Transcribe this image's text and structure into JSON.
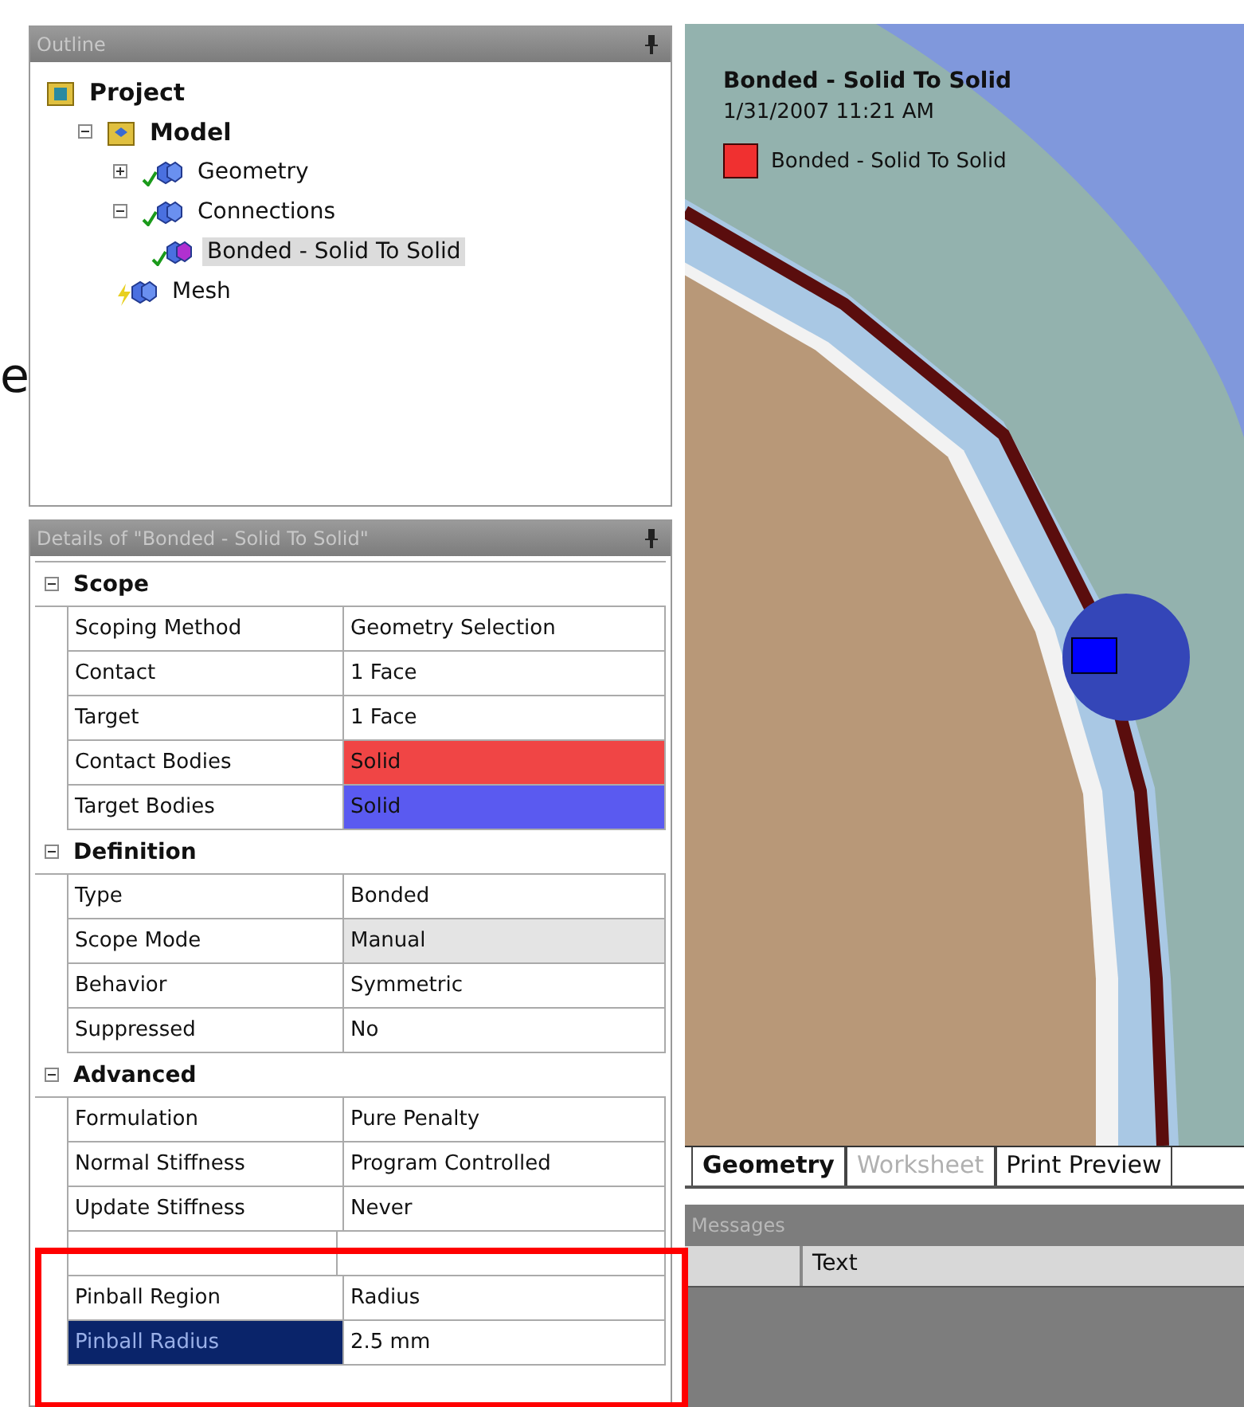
{
  "edge_text": "e",
  "outline": {
    "title": "Outline",
    "tree": [
      {
        "label": "Project",
        "kind": "project",
        "children": [
          {
            "label": "Model",
            "kind": "model",
            "expanded": true,
            "children": [
              {
                "label": "Geometry",
                "kind": "checked",
                "expanded": false,
                "selected": false
              },
              {
                "label": "Connections",
                "kind": "checked",
                "expanded": true,
                "selected": false,
                "children": [
                  {
                    "label": "Bonded - Solid To Solid",
                    "kind": "checked",
                    "selected": true
                  }
                ]
              },
              {
                "label": "Mesh",
                "kind": "pending",
                "selected": false
              }
            ]
          }
        ]
      }
    ]
  },
  "details": {
    "title": "Details of \"Bonded - Solid To Solid\"",
    "groups": [
      {
        "label": "Scope",
        "expanded": true,
        "rows": [
          {
            "name": "Scoping Method",
            "value": "Geometry Selection",
            "selected": false,
            "readonly": false
          },
          {
            "name": "Contact",
            "value": "1 Face",
            "selected": false,
            "readonly": false
          },
          {
            "name": "Target",
            "value": "1 Face",
            "selected": false,
            "readonly": false
          },
          {
            "name": "Contact Bodies",
            "value": "Solid",
            "selected": false,
            "readonly": false,
            "color": "#f04545"
          },
          {
            "name": "Target Bodies",
            "value": "Solid",
            "selected": false,
            "readonly": false,
            "color": "#5a5af0"
          }
        ]
      },
      {
        "label": "Definition",
        "expanded": true,
        "rows": [
          {
            "name": "Type",
            "value": "Bonded",
            "selected": false,
            "readonly": false
          },
          {
            "name": "Scope Mode",
            "value": "Manual",
            "selected": false,
            "readonly": true
          },
          {
            "name": "Behavior",
            "value": "Symmetric",
            "selected": false,
            "readonly": false
          },
          {
            "name": "Suppressed",
            "value": "No",
            "selected": false,
            "readonly": false
          }
        ]
      },
      {
        "label": "Advanced",
        "expanded": true,
        "rows": [
          {
            "name": "Formulation",
            "value": "Pure Penalty",
            "selected": false,
            "readonly": false
          },
          {
            "name": "Normal Stiffness",
            "value": "Program Controlled",
            "selected": false,
            "readonly": false
          },
          {
            "name": "Update Stiffness",
            "value": "Never",
            "selected": false,
            "readonly": false
          },
          {
            "kind": "covered"
          },
          {
            "name": "Pinball Region",
            "value": "Radius",
            "selected": false,
            "readonly": false
          },
          {
            "name": "Pinball Radius",
            "value": "2.5 mm",
            "selected": true,
            "readonly": false
          }
        ]
      }
    ]
  },
  "viewport": {
    "title": "Bonded - Solid To Solid",
    "timestamp": "1/31/2007 11:21 AM",
    "legend": [
      {
        "label": "Bonded - Solid To Solid",
        "color": "#f03030"
      }
    ]
  },
  "view_tabs": [
    {
      "label": "Geometry",
      "selected": true,
      "disabled": false
    },
    {
      "label": "Worksheet",
      "selected": false,
      "disabled": true
    },
    {
      "label": "Print Preview",
      "selected": false,
      "disabled": false
    }
  ],
  "messages": {
    "title": "Messages",
    "columns": [
      "Text"
    ]
  }
}
